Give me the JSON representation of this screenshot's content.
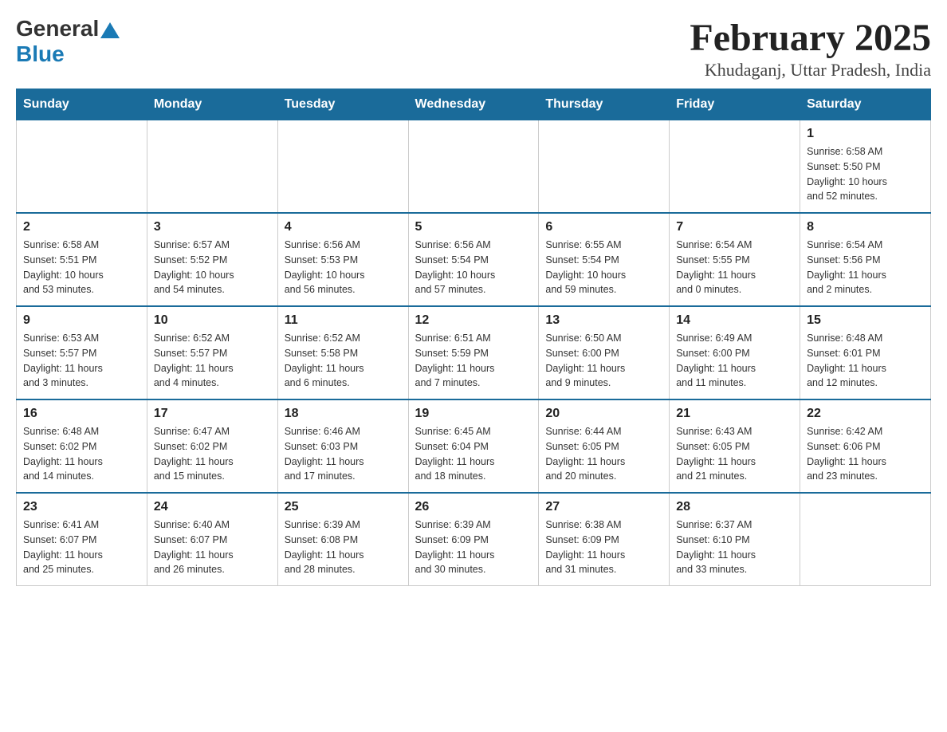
{
  "header": {
    "logo_general": "General",
    "logo_blue": "Blue",
    "title": "February 2025",
    "subtitle": "Khudaganj, Uttar Pradesh, India"
  },
  "days_of_week": [
    "Sunday",
    "Monday",
    "Tuesday",
    "Wednesday",
    "Thursday",
    "Friday",
    "Saturday"
  ],
  "weeks": [
    [
      {
        "day": "",
        "info": ""
      },
      {
        "day": "",
        "info": ""
      },
      {
        "day": "",
        "info": ""
      },
      {
        "day": "",
        "info": ""
      },
      {
        "day": "",
        "info": ""
      },
      {
        "day": "",
        "info": ""
      },
      {
        "day": "1",
        "info": "Sunrise: 6:58 AM\nSunset: 5:50 PM\nDaylight: 10 hours\nand 52 minutes."
      }
    ],
    [
      {
        "day": "2",
        "info": "Sunrise: 6:58 AM\nSunset: 5:51 PM\nDaylight: 10 hours\nand 53 minutes."
      },
      {
        "day": "3",
        "info": "Sunrise: 6:57 AM\nSunset: 5:52 PM\nDaylight: 10 hours\nand 54 minutes."
      },
      {
        "day": "4",
        "info": "Sunrise: 6:56 AM\nSunset: 5:53 PM\nDaylight: 10 hours\nand 56 minutes."
      },
      {
        "day": "5",
        "info": "Sunrise: 6:56 AM\nSunset: 5:54 PM\nDaylight: 10 hours\nand 57 minutes."
      },
      {
        "day": "6",
        "info": "Sunrise: 6:55 AM\nSunset: 5:54 PM\nDaylight: 10 hours\nand 59 minutes."
      },
      {
        "day": "7",
        "info": "Sunrise: 6:54 AM\nSunset: 5:55 PM\nDaylight: 11 hours\nand 0 minutes."
      },
      {
        "day": "8",
        "info": "Sunrise: 6:54 AM\nSunset: 5:56 PM\nDaylight: 11 hours\nand 2 minutes."
      }
    ],
    [
      {
        "day": "9",
        "info": "Sunrise: 6:53 AM\nSunset: 5:57 PM\nDaylight: 11 hours\nand 3 minutes."
      },
      {
        "day": "10",
        "info": "Sunrise: 6:52 AM\nSunset: 5:57 PM\nDaylight: 11 hours\nand 4 minutes."
      },
      {
        "day": "11",
        "info": "Sunrise: 6:52 AM\nSunset: 5:58 PM\nDaylight: 11 hours\nand 6 minutes."
      },
      {
        "day": "12",
        "info": "Sunrise: 6:51 AM\nSunset: 5:59 PM\nDaylight: 11 hours\nand 7 minutes."
      },
      {
        "day": "13",
        "info": "Sunrise: 6:50 AM\nSunset: 6:00 PM\nDaylight: 11 hours\nand 9 minutes."
      },
      {
        "day": "14",
        "info": "Sunrise: 6:49 AM\nSunset: 6:00 PM\nDaylight: 11 hours\nand 11 minutes."
      },
      {
        "day": "15",
        "info": "Sunrise: 6:48 AM\nSunset: 6:01 PM\nDaylight: 11 hours\nand 12 minutes."
      }
    ],
    [
      {
        "day": "16",
        "info": "Sunrise: 6:48 AM\nSunset: 6:02 PM\nDaylight: 11 hours\nand 14 minutes."
      },
      {
        "day": "17",
        "info": "Sunrise: 6:47 AM\nSunset: 6:02 PM\nDaylight: 11 hours\nand 15 minutes."
      },
      {
        "day": "18",
        "info": "Sunrise: 6:46 AM\nSunset: 6:03 PM\nDaylight: 11 hours\nand 17 minutes."
      },
      {
        "day": "19",
        "info": "Sunrise: 6:45 AM\nSunset: 6:04 PM\nDaylight: 11 hours\nand 18 minutes."
      },
      {
        "day": "20",
        "info": "Sunrise: 6:44 AM\nSunset: 6:05 PM\nDaylight: 11 hours\nand 20 minutes."
      },
      {
        "day": "21",
        "info": "Sunrise: 6:43 AM\nSunset: 6:05 PM\nDaylight: 11 hours\nand 21 minutes."
      },
      {
        "day": "22",
        "info": "Sunrise: 6:42 AM\nSunset: 6:06 PM\nDaylight: 11 hours\nand 23 minutes."
      }
    ],
    [
      {
        "day": "23",
        "info": "Sunrise: 6:41 AM\nSunset: 6:07 PM\nDaylight: 11 hours\nand 25 minutes."
      },
      {
        "day": "24",
        "info": "Sunrise: 6:40 AM\nSunset: 6:07 PM\nDaylight: 11 hours\nand 26 minutes."
      },
      {
        "day": "25",
        "info": "Sunrise: 6:39 AM\nSunset: 6:08 PM\nDaylight: 11 hours\nand 28 minutes."
      },
      {
        "day": "26",
        "info": "Sunrise: 6:39 AM\nSunset: 6:09 PM\nDaylight: 11 hours\nand 30 minutes."
      },
      {
        "day": "27",
        "info": "Sunrise: 6:38 AM\nSunset: 6:09 PM\nDaylight: 11 hours\nand 31 minutes."
      },
      {
        "day": "28",
        "info": "Sunrise: 6:37 AM\nSunset: 6:10 PM\nDaylight: 11 hours\nand 33 minutes."
      },
      {
        "day": "",
        "info": ""
      }
    ]
  ]
}
